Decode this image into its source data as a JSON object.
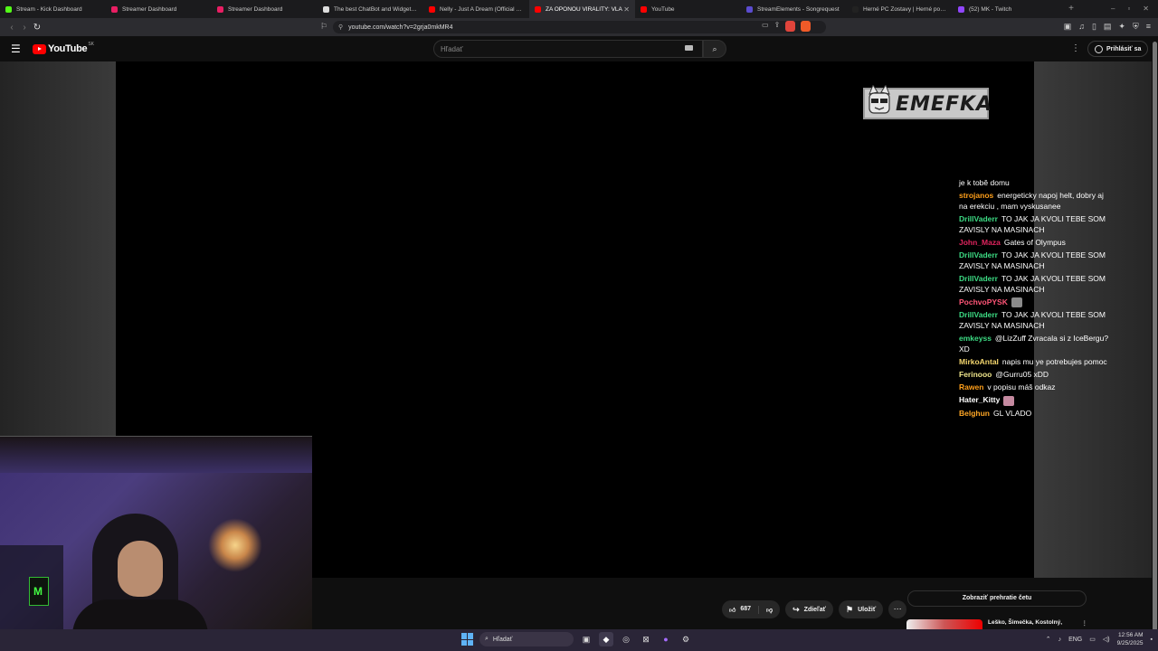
{
  "browser": {
    "tabs": [
      {
        "label": "Stream - Kick Dashboard",
        "color": "#53fc18"
      },
      {
        "label": "Streamer Dashboard",
        "color": "#e91e63"
      },
      {
        "label": "Streamer Dashboard",
        "color": "#e91e63"
      },
      {
        "label": "The best ChatBot and Widgets for",
        "color": "#dddddd"
      },
      {
        "label": "Nelly - Just A Dream (Official Musi",
        "color": "#ff0000"
      },
      {
        "label": "ZA OPONOU VIRALITY: VLA",
        "color": "#ff0000",
        "active": true
      },
      {
        "label": "YouTube",
        "color": "#ff0000"
      },
      {
        "label": "StreamElements - Songrequest",
        "color": "#5b4ccf"
      },
      {
        "label": "Herné PC Zostavy | Herné počítač",
        "color": "#222222"
      },
      {
        "label": "(52) MK - Twitch",
        "color": "#9146ff"
      }
    ],
    "url": "youtube.com/watch?v=2grja0mkMR4"
  },
  "youtube": {
    "logo_text": "YouTube",
    "country": "SK",
    "search_placeholder": "Hľadať",
    "sign_in": "Prihlásiť sa"
  },
  "overlay": {
    "brand": "EMEFKA"
  },
  "chat": {
    "messages": [
      {
        "user": "",
        "color": "#ff4d4d",
        "text": "je k tobě domu"
      },
      {
        "user": "strojanos",
        "color": "#ff9f1a",
        "text": "energeticky napoj helt, dobry aj na erekciu , mam vyskusanee"
      },
      {
        "user": "DrillVaderr",
        "color": "#3ddc84",
        "text": "TO JAK JA KVOLI TEBE SOM ZAVISLY NA MASINACH"
      },
      {
        "user": "John_Maza",
        "color": "#e0245e",
        "text": "Gates of Olympus"
      },
      {
        "user": "DrillVaderr",
        "color": "#3ddc84",
        "text": "TO JAK JA KVOLI TEBE SOM ZAVISLY NA MASINACH"
      },
      {
        "user": "DrillVaderr",
        "color": "#3ddc84",
        "text": "TO JAK JA KVOLI TEBE SOM ZAVISLY NA MASINACH"
      },
      {
        "user": "PochvoPYSK",
        "color": "#ff5577",
        "text": "",
        "emote": "grey"
      },
      {
        "user": "DrillVaderr",
        "color": "#3ddc84",
        "text": "TO JAK JA KVOLI TEBE SOM ZAVISLY NA MASINACH"
      },
      {
        "user": "emkeyss",
        "color": "#3ddc84",
        "text": "@LizZuff Zvracala si z IceBergu? XD"
      },
      {
        "user": "MirkoAntal",
        "color": "#f5d76e",
        "text": "napis mu ye potrebujes pomoc"
      },
      {
        "user": "Ferinooo",
        "color": "#f0e68c",
        "text": "@Gurru05 xDD"
      },
      {
        "user": "Rawen",
        "color": "#ff9f1a",
        "text": "v popisu máš odkaz"
      },
      {
        "user": "Hater_Kitty",
        "color": "#ffffff",
        "text": "",
        "emote": "pink"
      },
      {
        "user": "Belghun",
        "color": "#ffa726",
        "text": "GL VLADO"
      }
    ]
  },
  "actions": {
    "likes": "687",
    "share": "Zdieľať",
    "save": "Uložiť"
  },
  "chat_replay": "Zobraziť prehratie četu",
  "recommendation": {
    "title": "Leško, Šimečka, Kostolný,"
  },
  "taskbar": {
    "search": "Hľadať",
    "language": "ENG",
    "time": "12:56 AM",
    "date": "9/25/2025"
  }
}
